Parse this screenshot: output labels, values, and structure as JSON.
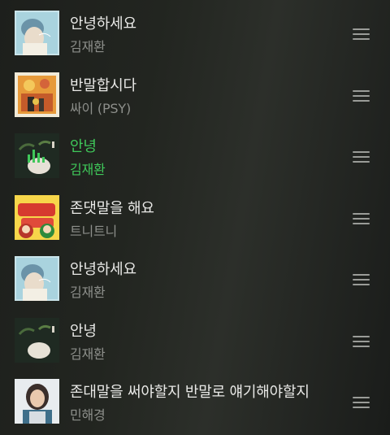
{
  "playlist": {
    "tracks": [
      {
        "title": "안녕하세요",
        "artist": "김재환",
        "cover": "album-cover-hello",
        "playing": false
      },
      {
        "title": "반말합시다",
        "artist": "싸이 (PSY)",
        "cover": "album-cover-psy",
        "playing": false
      },
      {
        "title": "안녕",
        "artist": "김재환",
        "cover": "album-cover-annyeong",
        "playing": true
      },
      {
        "title": "존댓말을 해요",
        "artist": "트니트니",
        "cover": "album-cover-tntn",
        "playing": false
      },
      {
        "title": "안녕하세요",
        "artist": "김재환",
        "cover": "album-cover-hello",
        "playing": false
      },
      {
        "title": "안녕",
        "artist": "김재환",
        "cover": "album-cover-annyeong",
        "playing": false
      },
      {
        "title": "존대말을 써야할지 반말로 얘기해야할지",
        "artist": "민해경",
        "cover": "album-cover-minhaekyung",
        "playing": false
      }
    ]
  },
  "colors": {
    "playing_accent": "#3fc85a",
    "title_text": "#e9e9e7",
    "artist_text": "#8d8f8b"
  }
}
